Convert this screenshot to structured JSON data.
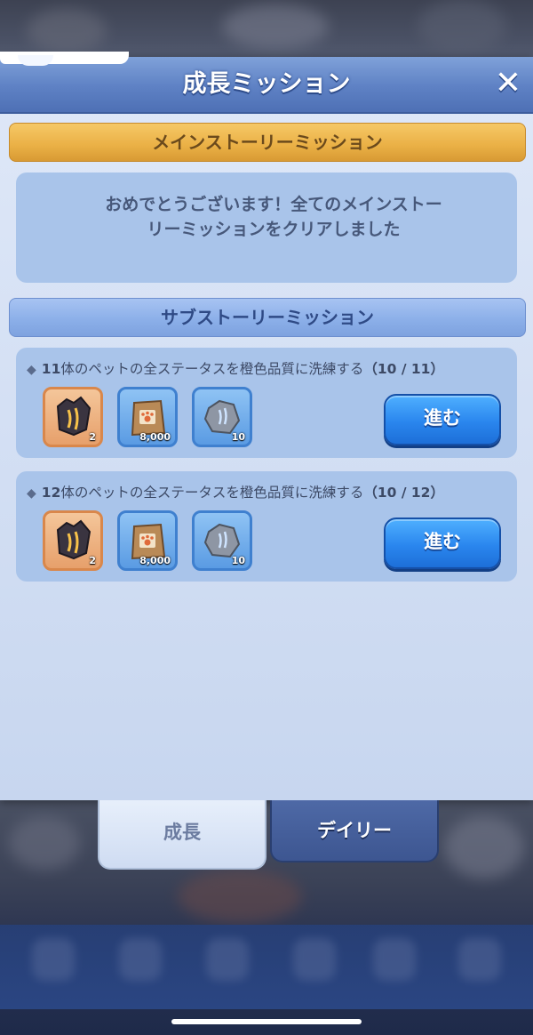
{
  "header": {
    "title": "成長ミッション",
    "close_icon": "close-icon"
  },
  "main_story": {
    "title": "メインストーリーミッション",
    "message": "おめでとうございます！全てのメインストーリーミッションをクリアしました"
  },
  "sub_story": {
    "title": "サブストーリーミッション",
    "missions": [
      {
        "count": "11",
        "text": "体のペットの全ステータスを橙色品質に洗練する",
        "progress": "（10 / 11）",
        "rewards": [
          {
            "icon": "dark-ore-icon",
            "quantity": "2"
          },
          {
            "icon": "pet-food-bag-icon",
            "quantity": "8,000"
          },
          {
            "icon": "gray-stone-icon",
            "quantity": "10"
          }
        ],
        "button_label": "進む"
      },
      {
        "count": "12",
        "text": "体のペットの全ステータスを橙色品質に洗練する",
        "progress": "（10 / 12）",
        "rewards": [
          {
            "icon": "dark-ore-icon",
            "quantity": "2"
          },
          {
            "icon": "pet-food-bag-icon",
            "quantity": "8,000"
          },
          {
            "icon": "gray-stone-icon",
            "quantity": "10"
          }
        ],
        "button_label": "進む"
      }
    ]
  },
  "tabs": {
    "growth": "成長",
    "daily": "デイリー"
  },
  "colors": {
    "header": "#5e81c4",
    "main_bar": "#eab045",
    "sub_bar": "#8aaee8",
    "go_button": "#2a86ee"
  }
}
